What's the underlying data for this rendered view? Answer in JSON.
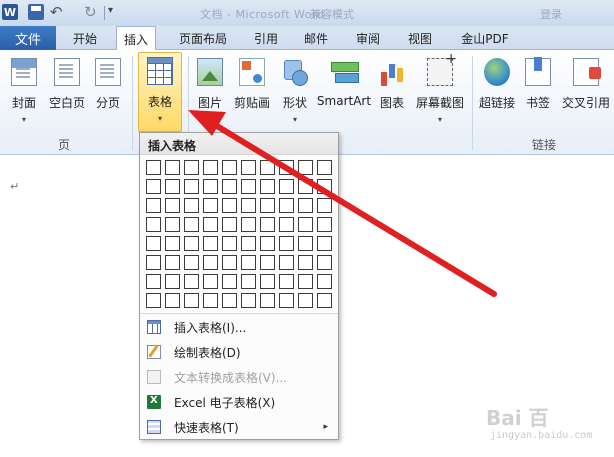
{
  "window": {
    "app_logo": "W",
    "title_segments": [
      "文档 - Microsoft Word",
      "兼容模式",
      "登录"
    ]
  },
  "qat": {
    "save_icon": "save-icon",
    "undo_icon": "↶",
    "redo_icon": "↻",
    "more": "▾"
  },
  "tabs": {
    "file": "文件",
    "items": [
      "开始",
      "插入",
      "页面布局",
      "引用",
      "邮件",
      "审阅",
      "视图",
      "金山PDF"
    ],
    "active": "插入"
  },
  "ribbon": {
    "buttons": [
      {
        "label": "封面",
        "drop": "▾",
        "icon": "cover-page-icon"
      },
      {
        "label": "空白页",
        "icon": "blank-page-icon"
      },
      {
        "label": "分页",
        "icon": "page-break-icon"
      },
      {
        "label": "表格",
        "drop": "▾",
        "icon": "table-icon"
      },
      {
        "label": "图片",
        "icon": "picture-icon"
      },
      {
        "label": "剪贴画",
        "icon": "clip-art-icon"
      },
      {
        "label": "形状",
        "drop": "▾",
        "icon": "shapes-icon"
      },
      {
        "label": "SmartArt",
        "icon": "smartart-icon"
      },
      {
        "label": "图表",
        "icon": "chart-icon"
      },
      {
        "label": "屏幕截图",
        "drop": "▾",
        "icon": "screenshot-icon"
      },
      {
        "label": "超链接",
        "icon": "hyperlink-icon"
      },
      {
        "label": "书签",
        "icon": "bookmark-icon"
      },
      {
        "label": "交叉引用",
        "icon": "cross-reference-icon"
      }
    ],
    "group_labels": [
      "页",
      "链接"
    ]
  },
  "document": {
    "paragraph_mark": "↵"
  },
  "table_menu": {
    "header": "插入表格",
    "grid_columns": 10,
    "grid_rows": 8,
    "items": [
      {
        "label": "插入表格(I)...",
        "icon": "insert-table-icon",
        "enabled": true
      },
      {
        "label": "绘制表格(D)",
        "icon": "draw-table-icon",
        "enabled": true
      },
      {
        "label": "文本转换成表格(V)...",
        "icon": "convert-text-icon",
        "enabled": false
      },
      {
        "label": "Excel 电子表格(X)",
        "icon": "excel-icon",
        "enabled": true
      },
      {
        "label": "快速表格(T)",
        "icon": "quick-table-icon",
        "enabled": true,
        "submenu": "▸"
      }
    ]
  },
  "annotation": {
    "arrow_color": "#e02020"
  },
  "watermark": {
    "text": "Bai 百",
    "sub": "jingyan.baidu.com"
  },
  "colors": {
    "file_tab": "#2a5fa8",
    "highlight": "#ffd966"
  }
}
